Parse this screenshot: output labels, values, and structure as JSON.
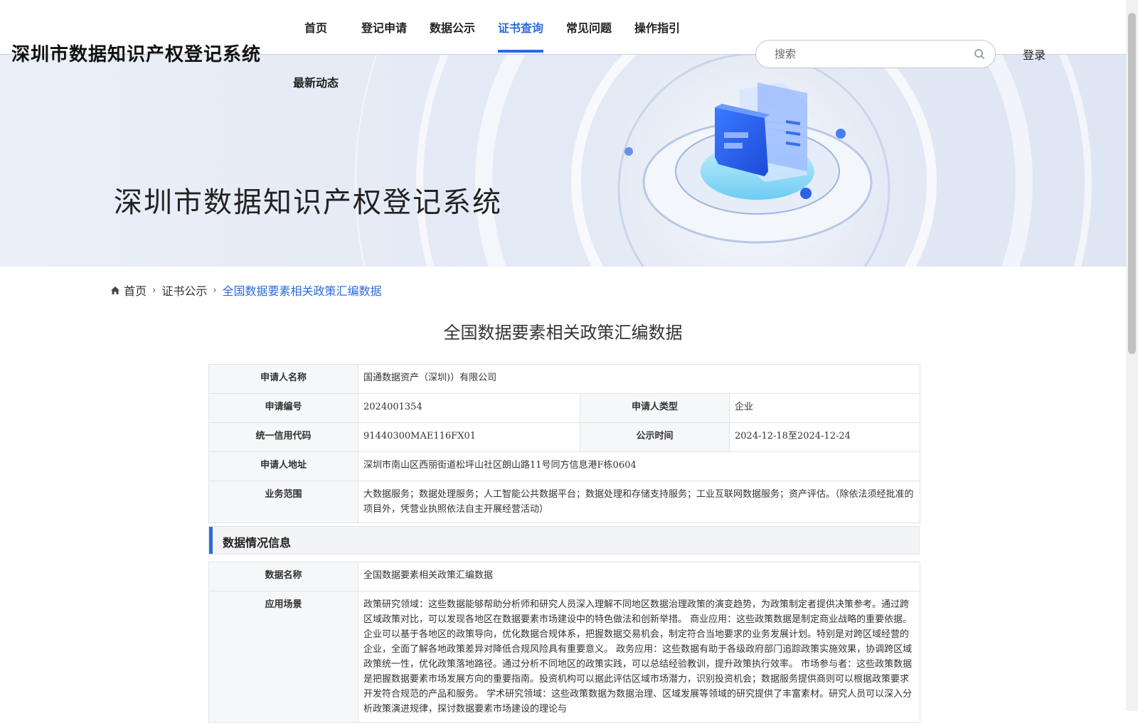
{
  "site": {
    "logo": "深圳市数据知识产权登记系统"
  },
  "nav": {
    "items": [
      "首页",
      "登记申请",
      "数据公示",
      "证书查询",
      "常见问题",
      "操作指引"
    ],
    "second_row": "最新动态",
    "active": "证书查询"
  },
  "search": {
    "placeholder": "搜索",
    "icon": "search-icon"
  },
  "login": "登录",
  "banner": {
    "title": "深圳市数据知识产权登记系统"
  },
  "breadcrumb": {
    "home": "首页",
    "level2": "证书公示",
    "current": "全国数据要素相关政策汇编数据"
  },
  "page_title": "全国数据要素相关政策汇编数据",
  "applicant": {
    "name_label": "申请人名称",
    "name_value": "国通数据资产（深圳)）有限公司",
    "number_label": "申请编号",
    "number_value": "2024001354",
    "type_label": "申请人类型",
    "type_value": "企业",
    "credit_label": "统一信用代码",
    "credit_value": "91440300MAE116FX01",
    "period_label": "公示时间",
    "period_value": "2024-12-18至2024-12-24",
    "address_label": "申请人地址",
    "address_value": "深圳市南山区西丽街道松坪山社区朗山路11号同方信息港F栋0604",
    "scope_label": "业务范围",
    "scope_value": "大数据服务；数据处理服务；人工智能公共数据平台；数据处理和存储支持服务；工业互联网数据服务；资产评估。（除依法须经批准的项目外，凭营业执照依法自主开展经营活动）"
  },
  "data_section": {
    "heading": "数据情况信息",
    "name_label": "数据名称",
    "name_value": "全国数据要素相关政策汇编数据",
    "scene_label": "应用场景",
    "scene_value": "政策研究领域：这些数据能够帮助分析师和研究人员深入理解不同地区数据治理政策的演变趋势，为政策制定者提供决策参考。通过跨区域政策对比，可以发现各地区在数据要素市场建设中的特色做法和创新举措。 商业应用：这些政策数据是制定商业战略的重要依据。企业可以基于各地区的政策导向，优化数据合规体系，把握数据交易机会，制定符合当地要求的业务发展计划。特别是对跨区域经营的企业，全面了解各地政策差异对降低合规风险具有重要意义。 政务应用：这些数据有助于各级政府部门追踪政策实施效果，协调跨区域政策统一性，优化政策落地路径。通过分析不同地区的政策实践，可以总结经验教训，提升政策执行效率。 市场参与者：这些政策数据是把握数据要素市场发展方向的重要指南。投资机构可以据此评估区域市场潜力，识别投资机会；数据服务提供商则可以根据政策要求开发符合规范的产品和服务。 学术研究领域：这些政策数据为数据治理、区域发展等领域的研究提供了丰富素材。研究人员可以深入分析政策演进规律，探讨数据要素市场建设的理论与"
  }
}
